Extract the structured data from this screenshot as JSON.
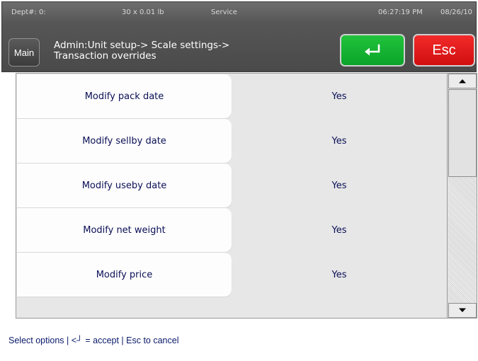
{
  "status": {
    "dept": "Dept#: 0:",
    "weight": "30 x 0.01 lb",
    "mode": "Service",
    "time": "06:27:19 PM",
    "date": "08/26/10"
  },
  "header": {
    "main_label": "Main",
    "breadcrumb_line1": "Admin:Unit setup-> Scale settings->",
    "breadcrumb_line2": "Transaction overrides",
    "esc_label": "Esc"
  },
  "rows": [
    {
      "label": "Modify pack date",
      "value": "Yes"
    },
    {
      "label": "Modify sellby date",
      "value": "Yes"
    },
    {
      "label": "Modify useby date",
      "value": "Yes"
    },
    {
      "label": "Modify net weight",
      "value": "Yes"
    },
    {
      "label": "Modify price",
      "value": "Yes"
    }
  ],
  "footer": {
    "hint": "Select options | <┘ = accept | Esc to cancel"
  },
  "icons": {
    "enter": "enter-return-icon",
    "scroll_up": "triangle-up-icon",
    "scroll_down": "triangle-down-icon"
  },
  "colors": {
    "accept_button": "#12b22f",
    "escape_button": "#e51b1b",
    "text_dark_blue": "#0a0f55",
    "header_bg": "#555555"
  }
}
